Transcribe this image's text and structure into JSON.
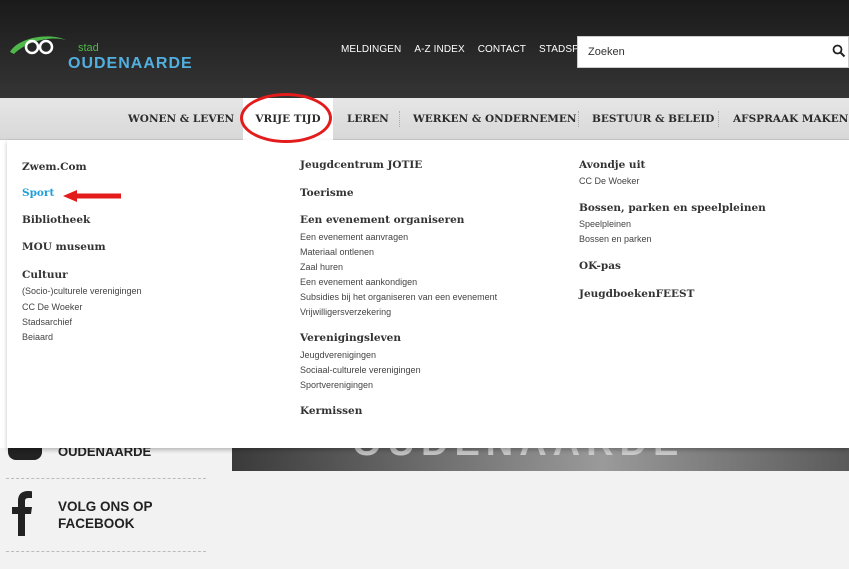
{
  "header": {
    "logo": {
      "top_text": "stad",
      "city_text": "OUDENAARDE"
    },
    "util_nav": [
      "MELDINGEN",
      "A-Z INDEX",
      "CONTACT",
      "STADSPLAN"
    ],
    "search": {
      "placeholder": "Zoeken",
      "icon": "search-icon"
    }
  },
  "main_nav": {
    "items": [
      "WONEN & LEVEN",
      "VRIJE TIJD",
      "LEREN",
      "WERKEN & ONDERNEMEN",
      "BESTUUR & BELEID",
      "AFSPRAAK MAKEN"
    ],
    "active": "VRIJE TIJD"
  },
  "dropdown": {
    "col1": {
      "headings": [
        "Zwem.Com",
        "Sport",
        "Bibliotheek",
        "MOU museum",
        "Cultuur"
      ],
      "cultuur_items": [
        "(Socio-)culturele verenigingen",
        "CC De Woeker",
        "Stadsarchief",
        "Beiaard"
      ]
    },
    "col2": {
      "h1": "Jeugdcentrum JOTIE",
      "h2": "Toerisme",
      "h3": "Een evenement organiseren",
      "evenement_items": [
        "Een evenement aanvragen",
        "Materiaal ontlenen",
        "Zaal huren",
        "Een evenement aankondigen",
        "Subsidies bij het organiseren van een evenement",
        "Vrijwilligersverzekering"
      ],
      "h4": "Verenigingsleven",
      "vereniging_items": [
        "Jeugdverenigingen",
        "Sociaal-culturele verenigingen",
        "Sportverenigingen"
      ],
      "h5": "Kermissen"
    },
    "col3": {
      "h1": "Avondje uit",
      "avond_items": [
        "CC De Woeker"
      ],
      "h2": "Bossen, parken en speelpleinen",
      "bossen_items": [
        "Speelpleinen",
        "Bossen en parken"
      ],
      "h3": "OK-pas",
      "h4": "JeugdboekenFEEST"
    }
  },
  "background": {
    "left_title": "OUDENAARDE",
    "banner_text": "OUDENAARDE",
    "facebook": "VOLG ONS OP FACEBOOK"
  },
  "colors": {
    "accent_blue": "#1f9fd8",
    "annotation_red": "#e31b1b",
    "logo_green": "#4fb84a"
  }
}
